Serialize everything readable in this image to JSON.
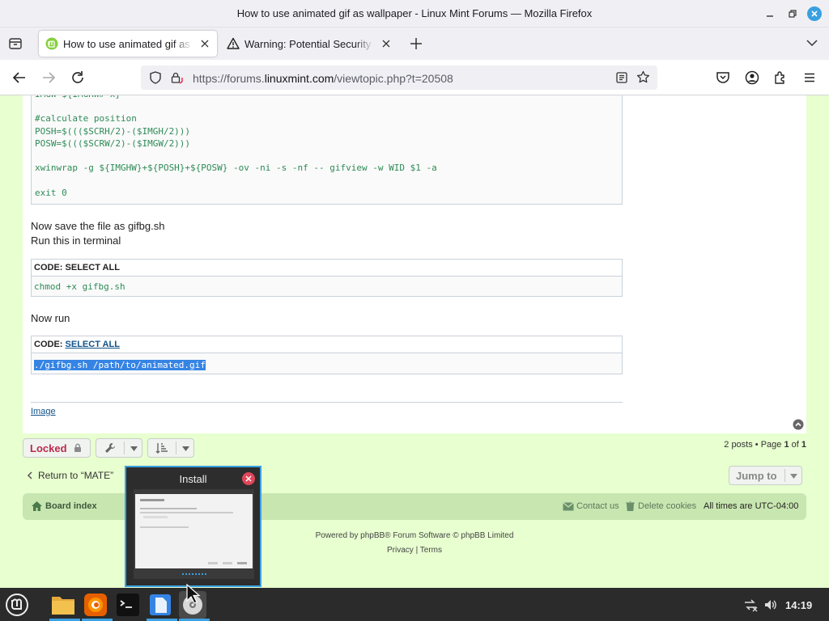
{
  "window": {
    "title": "How to use animated gif as wallpaper - Linux Mint Forums — Mozilla Firefox"
  },
  "tabs": [
    {
      "label": "How to use animated gif as wallpaper",
      "active": true
    },
    {
      "label": "Warning: Potential Security Risk Ahead",
      "active": false
    }
  ],
  "urlbar": {
    "prefix": "https://forums.",
    "domain": "linuxmint.com",
    "path": "/viewtopic.php?t=20508"
  },
  "post": {
    "code1_lines": [
      "IMGW=${IMGHW#*x}",
      "",
      "#calculate position",
      "POSH=$((($SCRH/2)-($IMGH/2)))",
      "POSW=$((($SCRW/2)-($IMGW/2)))",
      "",
      "xwinwrap -g ${IMGHW}+${POSH}+${POSW} -ov -ni -s -nf -- gifview -w WID $1 -a",
      "",
      "exit 0"
    ],
    "text_save": "Now save the file as gifbg.sh",
    "text_run_terminal": "Run this in terminal",
    "code_label": "CODE:",
    "select_all": "SELECT ALL",
    "code2": "chmod +x gifbg.sh",
    "text_now_run": "Now run",
    "code3": "./gifbg.sh /path/to/animated.gif",
    "image_link": "Image"
  },
  "actions": {
    "locked": "Locked",
    "pagination": {
      "prefix": "2 posts • Page ",
      "current": "1",
      "of": " of ",
      "total": "1"
    },
    "return_link": "Return to “MATE”",
    "jump_to": "Jump to"
  },
  "footer": {
    "board_index": "Board index",
    "contact_us": "Contact us",
    "delete_cookies": "Delete cookies",
    "timezone_prefix": "All times are ",
    "timezone": "UTC-04:00",
    "powered_by": "Powered by phpBB® Forum Software © phpBB Limited",
    "privacy": "Privacy",
    "separator": "|",
    "terms": "Terms"
  },
  "preview": {
    "title": "Install"
  },
  "taskbar": {
    "clock": "14:19"
  },
  "colors": {
    "page_bg": "#e8ffd0",
    "footer_bar": "#c8e6b0",
    "code_text": "#2e8b57",
    "link": "#105289",
    "locked_text": "#bc2a4d",
    "selection": "#3584e4",
    "taskbar": "#2b2b2b",
    "preview_border": "#3aa0e0"
  }
}
